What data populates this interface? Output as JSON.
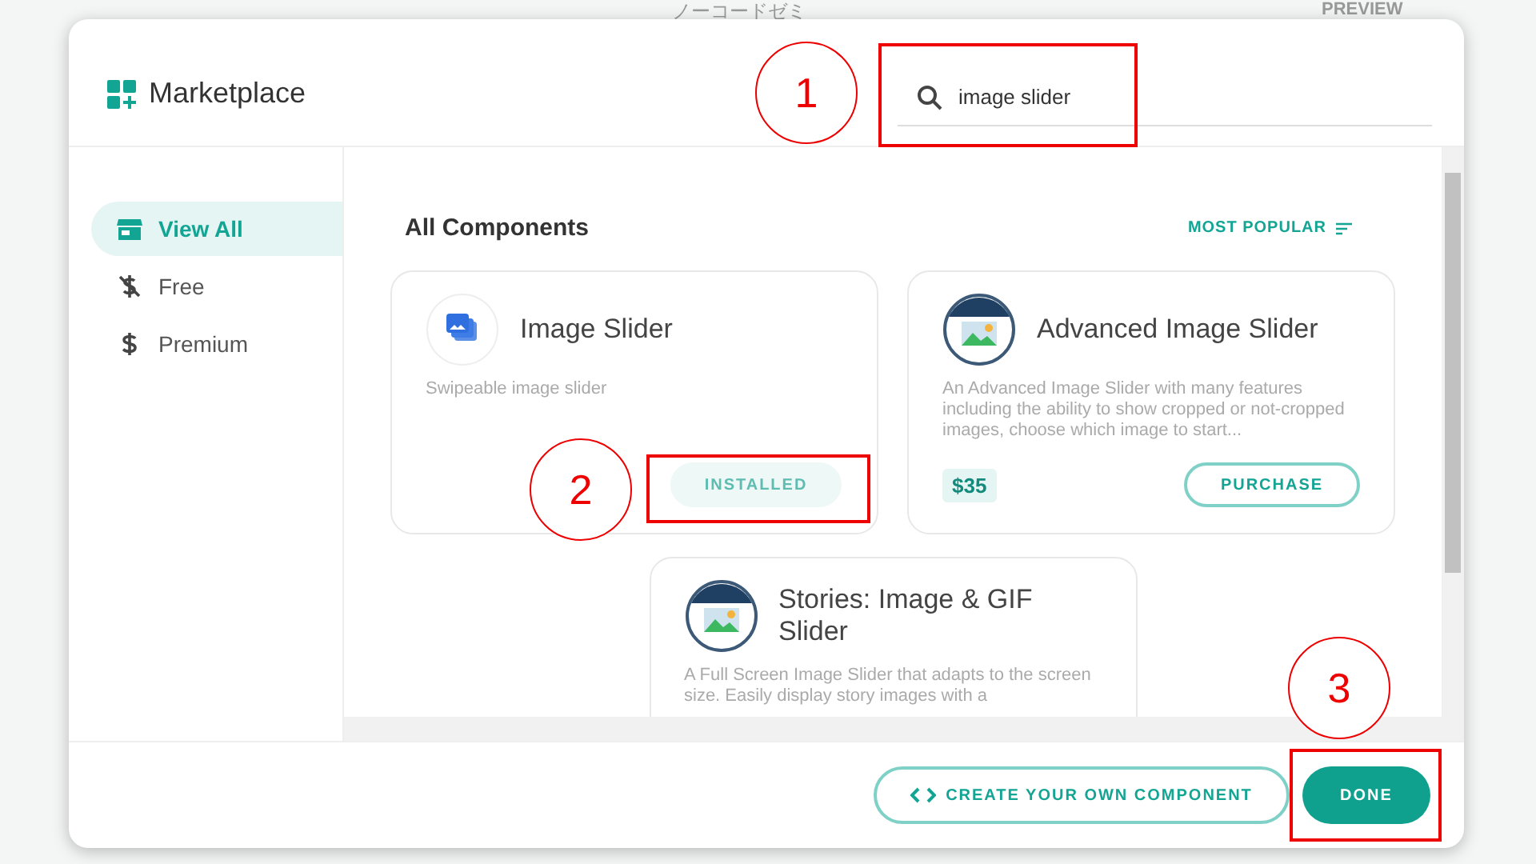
{
  "backdrop": {
    "title": "ノーコードゼミ",
    "preview": "PREVIEW"
  },
  "dialog": {
    "title": "Marketplace",
    "search": {
      "value": "image slider"
    },
    "sidebar": {
      "items": [
        {
          "label": "View All",
          "selected": true
        },
        {
          "label": "Free",
          "selected": false
        },
        {
          "label": "Premium",
          "selected": false
        }
      ]
    },
    "section_title": "All Components",
    "sort": "MOST POPULAR",
    "components": [
      {
        "kind": "basic",
        "title": "Image Slider",
        "description": "Swipeable image slider",
        "action": "INSTALLED",
        "installed": true
      },
      {
        "kind": "framed",
        "title": "Advanced Image Slider",
        "description": "An Advanced Image Slider with many features including the ability to show cropped or not-cropped images, choose which image to start...",
        "price": "$35",
        "action": "PURCHASE",
        "installed": false
      },
      {
        "kind": "framed",
        "title": "Stories: Image & GIF Slider",
        "description": "A Full Screen Image Slider that adapts to the screen size. Easily display story images with a"
      }
    ],
    "footer": {
      "create_button": "CREATE YOUR OWN COMPONENT",
      "done_button": "DONE"
    }
  },
  "annotations": [
    {
      "number": "1"
    },
    {
      "number": "2"
    },
    {
      "number": "3"
    }
  ]
}
